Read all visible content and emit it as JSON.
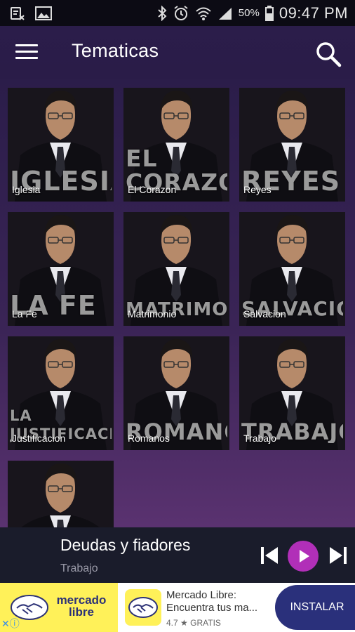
{
  "status_bar": {
    "battery": "50%",
    "time": "09:47 PM"
  },
  "app_bar": {
    "title": "Tematicas"
  },
  "tiles": [
    {
      "overlay_lines": [
        "IGLESIA"
      ],
      "caption": "Iglesia"
    },
    {
      "overlay_lines": [
        "EL",
        "CORAZON"
      ],
      "caption": "El Corazon"
    },
    {
      "overlay_lines": [
        "REYES"
      ],
      "caption": "Reyes"
    },
    {
      "overlay_lines": [
        "LA FE"
      ],
      "caption": "La Fe"
    },
    {
      "overlay_lines": [
        "MATRIMONIO"
      ],
      "caption": "Matrimonio"
    },
    {
      "overlay_lines": [
        "SALVACION"
      ],
      "caption": "Salvacion"
    },
    {
      "overlay_lines": [
        "LA",
        "JUSTIFICACION"
      ],
      "caption": "Justificacion"
    },
    {
      "overlay_lines": [
        "ROMANOS"
      ],
      "caption": "Romanos"
    },
    {
      "overlay_lines": [
        "TRABAJO"
      ],
      "caption": "Trabajo"
    },
    {
      "overlay_lines": [],
      "caption": ""
    }
  ],
  "player": {
    "title": "Deudas y fiadores",
    "subtitle": "Trabajo"
  },
  "ad": {
    "logo_text": "mercado libre",
    "title": "Mercado Libre: Encuentra tus ma...",
    "rating": "4.7",
    "price": "GRATIS",
    "button": "INSTALAR"
  },
  "colors": {
    "app_bar": "#2b1d4a",
    "accent_play": "#b12fb8",
    "ad_yellow": "#fff159",
    "ad_blue": "#2a307b"
  }
}
